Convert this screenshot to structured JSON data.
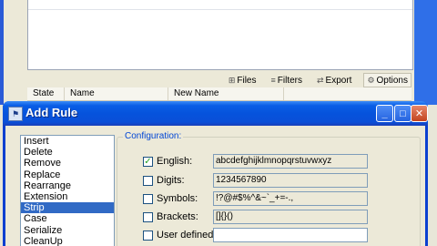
{
  "main_window": {
    "toolbar": [
      {
        "label": "Files",
        "icon": "files-icon",
        "glyph": "⊞"
      },
      {
        "label": "Filters",
        "icon": "filter-icon",
        "glyph": "≡"
      },
      {
        "label": "Export",
        "icon": "export-icon",
        "glyph": "⇄"
      },
      {
        "label": "Options",
        "icon": "options-icon",
        "glyph": "⚙"
      }
    ],
    "columns": [
      "State",
      "Name",
      "New Name"
    ]
  },
  "dialog": {
    "title": "Add Rule",
    "controls": {
      "minimize": "_",
      "maximize": "□",
      "close": "✕"
    },
    "rules": [
      "Insert",
      "Delete",
      "Remove",
      "Replace",
      "Rearrange",
      "Extension",
      "Strip",
      "Case",
      "Serialize",
      "CleanUp"
    ],
    "selected_rule": "Strip",
    "configuration": {
      "legend": "Configuration:",
      "options": [
        {
          "label": "English:",
          "checked": true,
          "value": "abcdefghijklmnopqrstuvwxyz"
        },
        {
          "label": "Digits:",
          "checked": false,
          "value": "1234567890"
        },
        {
          "label": "Symbols:",
          "checked": false,
          "value": "!?@#$%^&~`_+=-.,"
        },
        {
          "label": "Brackets:",
          "checked": false,
          "value": "[]{}()"
        },
        {
          "label": "User defined:",
          "checked": false,
          "value": ""
        }
      ]
    }
  },
  "colors": {
    "title_bar": "#0653dc",
    "selection": "#316ac5",
    "legend": "#0046d5"
  }
}
